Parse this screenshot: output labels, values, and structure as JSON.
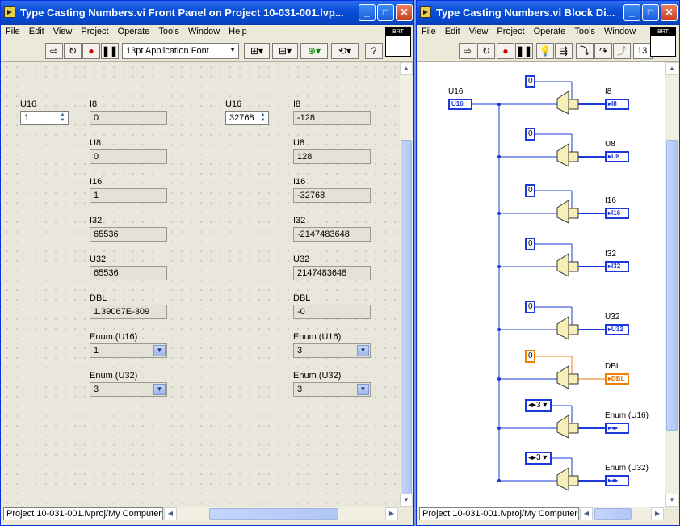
{
  "front_panel": {
    "title": "Type Casting Numbers.vi Front Panel on Project 10-031-001.lvp...",
    "menu": [
      "File",
      "Edit",
      "View",
      "Project",
      "Operate",
      "Tools",
      "Window",
      "Help"
    ],
    "font_select": "13pt Application Font",
    "brt_label": "BRT",
    "left": {
      "control": {
        "label": "U16",
        "value": "1"
      },
      "indicators": [
        {
          "label": "I8",
          "value": "0"
        },
        {
          "label": "U8",
          "value": "0"
        },
        {
          "label": "I16",
          "value": "1"
        },
        {
          "label": "I32",
          "value": "65536"
        },
        {
          "label": "U32",
          "value": "65536"
        },
        {
          "label": "DBL",
          "value": "1.39067E-309"
        }
      ],
      "enums": [
        {
          "label": "Enum (U16)",
          "value": "1"
        },
        {
          "label": "Enum (U32)",
          "value": "3"
        }
      ]
    },
    "right": {
      "control": {
        "label": "U16",
        "value": "32768"
      },
      "indicators": [
        {
          "label": "I8",
          "value": "-128"
        },
        {
          "label": "U8",
          "value": "128"
        },
        {
          "label": "I16",
          "value": "-32768"
        },
        {
          "label": "I32",
          "value": "-2147483648"
        },
        {
          "label": "U32",
          "value": "2147483648"
        },
        {
          "label": "DBL",
          "value": "-0"
        }
      ],
      "enums": [
        {
          "label": "Enum (U16)",
          "value": "3"
        },
        {
          "label": "Enum (U32)",
          "value": "3"
        }
      ]
    },
    "status": "Project 10-031-001.lvproj/My Computer"
  },
  "block_diagram": {
    "title": "Type Casting Numbers.vi Block Di...",
    "menu": [
      "File",
      "Edit",
      "View",
      "Project",
      "Operate",
      "Tools",
      "Window"
    ],
    "brt_label": "BRT",
    "font_partial": "13",
    "source_terminal": {
      "label": "U16",
      "tag": "U16"
    },
    "casts": [
      {
        "const": "0",
        "label": "I8",
        "tag": "I8"
      },
      {
        "const": "0",
        "label": "U8",
        "tag": "U8"
      },
      {
        "const": "0",
        "label": "I16",
        "tag": "I16"
      },
      {
        "const": "0",
        "label": "I32",
        "tag": "I32"
      },
      {
        "const": "0",
        "label": "U32",
        "tag": "U32"
      },
      {
        "const": "0",
        "label": "DBL",
        "tag": "DBL"
      },
      {
        "const": "3",
        "label": "Enum (U16)",
        "tag": "◂▸"
      },
      {
        "const": "3",
        "label": "Enum (U32)",
        "tag": "◂▸"
      }
    ],
    "status": "Project 10-031-001.lvproj/My Computer"
  },
  "colors": {
    "wire": "#1c38d8",
    "dbl_wire": "#f08000",
    "titlebar": "#0a4fd8"
  }
}
